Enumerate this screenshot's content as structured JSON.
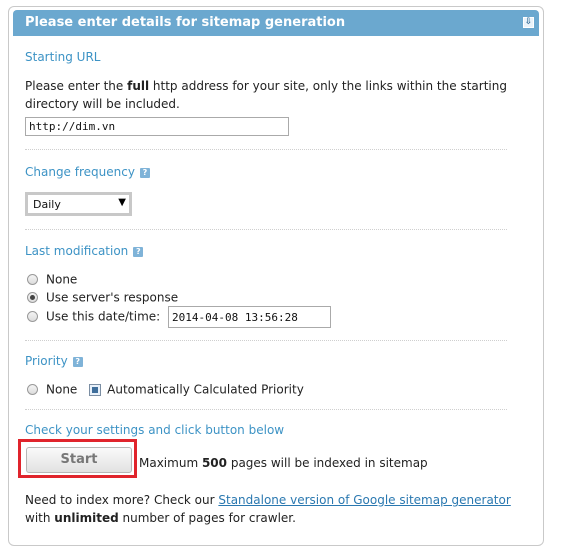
{
  "header": {
    "title": "Please enter details for sitemap generation",
    "collapse_icon": "collapse-icon"
  },
  "starting_url": {
    "title": "Starting URL",
    "desc_pre": "Please enter the ",
    "desc_bold": "full",
    "desc_post": " http address for your site, only the links within the starting",
    "desc_line2": "directory will be included.",
    "value": "http://dim.vn"
  },
  "change_frequency": {
    "title": "Change frequency",
    "help": "?",
    "selected": "Daily"
  },
  "last_modification": {
    "title": "Last modification",
    "help": "?",
    "options": [
      "None",
      "Use server's response",
      "Use this date/time:"
    ],
    "selected_index": 1,
    "datetime_value": "2014-04-08 13:56:28"
  },
  "priority": {
    "title": "Priority",
    "help": "?",
    "option_none": "None",
    "option_auto": "Automatically Calculated Priority"
  },
  "actions": {
    "title": "Check your settings and click button below",
    "start_label": "Start",
    "max_pre": "Maximum ",
    "max_count": "500",
    "max_post": " pages will be indexed in sitemap"
  },
  "footer": {
    "line1_pre": "Need to index more? Check our ",
    "link_text": "Standalone version of Google sitemap generator",
    "line2_pre": "with ",
    "line2_bold": "unlimited",
    "line2_post": " number of pages for crawler."
  }
}
